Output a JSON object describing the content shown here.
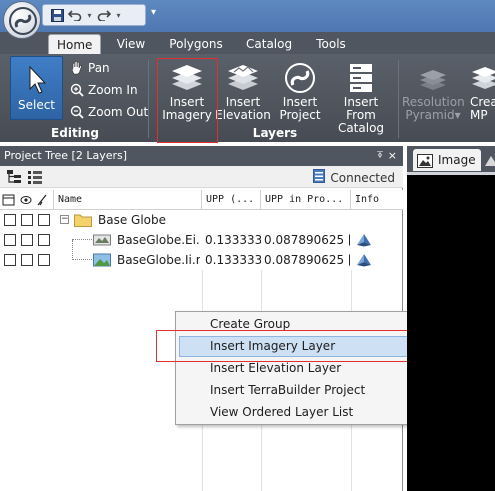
{
  "qat": {
    "save_icon": "save-icon",
    "undo_icon": "undo-icon",
    "redo_icon": "redo-icon"
  },
  "tabs": [
    {
      "label": "Home",
      "active": true
    },
    {
      "label": "View"
    },
    {
      "label": "Polygons"
    },
    {
      "label": "Catalog"
    },
    {
      "label": "Tools"
    }
  ],
  "ribbon": {
    "select": "Select",
    "pan": "Pan",
    "zoom_in": "Zoom In",
    "zoom_out": "Zoom Out",
    "editing_group": "Editing",
    "insert_imagery_1": "Insert",
    "insert_imagery_2": "Imagery",
    "insert_elevation_1": "Insert",
    "insert_elevation_2": "Elevation",
    "insert_project_1": "Insert",
    "insert_project_2": "Project",
    "insert_catalog_1": "Insert From",
    "insert_catalog_2": "Catalog",
    "layers_group": "Layers",
    "resolution_1": "Resolution",
    "resolution_2": "Pyramid",
    "cut_off_1": "Crea",
    "cut_off_2": "MP"
  },
  "panel": {
    "title": "Project Tree [2 Layers]",
    "pin": "⍕",
    "close": "×",
    "connected": "Connected"
  },
  "grid": {
    "headers": [
      "Name",
      "UPP (...",
      "UPP in Pro...",
      "Info"
    ],
    "group_name": "Base Globe",
    "rows": [
      {
        "name": "BaseGlobe.Ei.r",
        "upp": "0.133333",
        "upp_proj": "0.087890625 ["
      },
      {
        "name": "BaseGlobe.Ii.r",
        "upp": "0.133333",
        "upp_proj": "0.087890625 ["
      }
    ]
  },
  "menu": {
    "items": [
      "Create Group",
      "Insert Imagery Layer",
      "Insert Elevation Layer",
      "Insert TerraBuilder Project",
      "View Ordered Layer List"
    ]
  },
  "right": {
    "image_tab": "Image"
  },
  "colors": {
    "accent": "#3f7ec7",
    "highlight": "#e0312f",
    "ribbon": "#50565f"
  }
}
